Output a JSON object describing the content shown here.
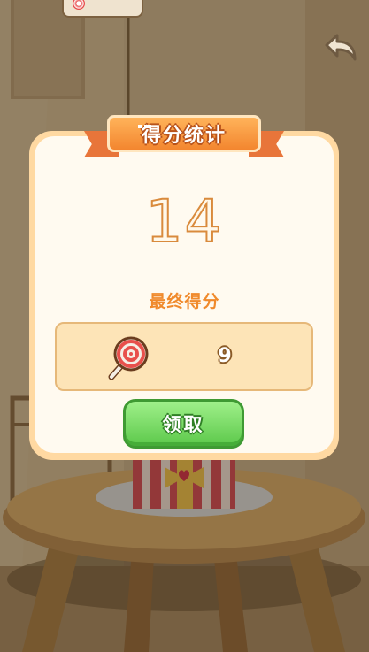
{
  "dialog": {
    "title": "得分统计",
    "score": "14",
    "score_label": "最终得分",
    "reward": {
      "icon": "lollipop-icon",
      "count": "9"
    },
    "claim_button": "领取"
  },
  "icons": {
    "back": "back-arrow-icon"
  },
  "colors": {
    "ribbon": "#f3862f",
    "dialog_border": "#ffd9a2",
    "dialog_bg": "#fffaf0",
    "label": "#f08a2c",
    "button": "#5cc84a"
  }
}
